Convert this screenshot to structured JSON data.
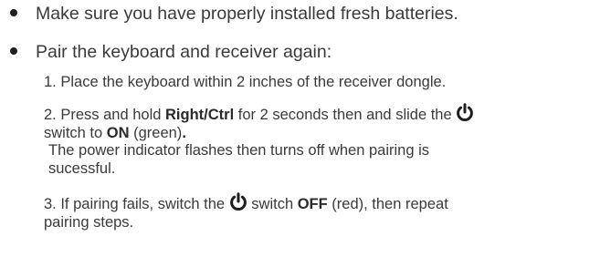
{
  "bullets": [
    {
      "text": "Make sure you have properly installed fresh batteries."
    },
    {
      "text": "Pair the keyboard and receiver again:"
    }
  ],
  "steps": {
    "s1": {
      "text": "1. Place the keyboard within 2 inches of the receiver dongle."
    },
    "s2": {
      "a": "2. Press and hold ",
      "key": "Right/Ctrl",
      "b": " for 2 seconds then and slide the ",
      "c": "switch to ",
      "on": "ON",
      "d": " (green)",
      "dot": "."
    },
    "note": {
      "line1": "The power indicator flashes then turns off when pairing is",
      "line2": "sucessful."
    },
    "s3": {
      "a": "3. If pairing fails, switch the ",
      "b": " switch ",
      "off": "OFF",
      "c": " (red), then repeat",
      "d": "pairing steps."
    }
  },
  "icons": {
    "power": "power-icon",
    "bullet": "bullet-dot-icon"
  },
  "colors": {
    "text": "#3a3a3a",
    "bullet": "#1e1e1e"
  }
}
